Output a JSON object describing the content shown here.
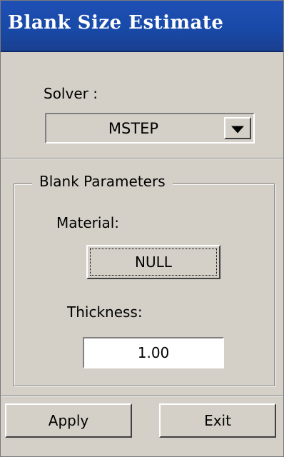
{
  "window": {
    "title": "Blank Size Estimate"
  },
  "solver": {
    "label": "Solver :",
    "selected": "MSTEP"
  },
  "blank_parameters": {
    "title": "Blank Parameters",
    "material_label": "Material:",
    "material_value": "NULL",
    "thickness_label": "Thickness:",
    "thickness_value": "1.00"
  },
  "actions": {
    "apply": "Apply",
    "exit": "Exit"
  },
  "colors": {
    "title_bar": "#1f4fb4",
    "title_text": "#ffffff",
    "dialog_background": "#d4d0c8"
  },
  "icons": {
    "dropdown": "triangle-down-icon"
  }
}
